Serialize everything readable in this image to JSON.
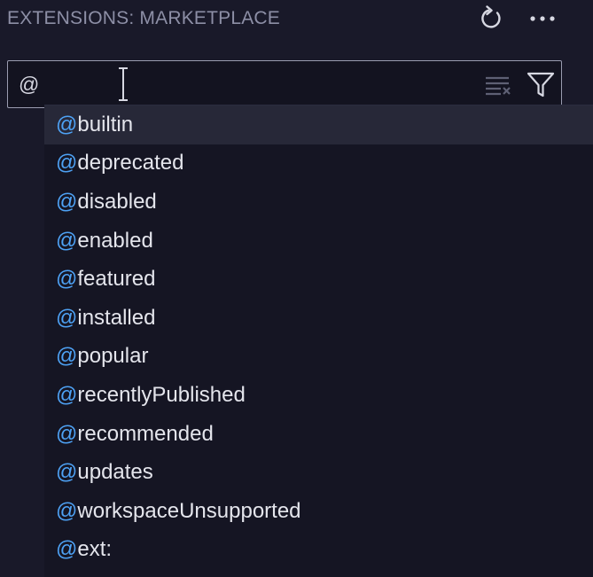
{
  "header": {
    "title": "EXTENSIONS: MARKETPLACE"
  },
  "search": {
    "value": "@"
  },
  "suggestions": {
    "prefix": "@",
    "items": [
      "builtin",
      "deprecated",
      "disabled",
      "enabled",
      "featured",
      "installed",
      "popular",
      "recentlyPublished",
      "recommended",
      "updates",
      "workspaceUnsupported",
      "ext:"
    ]
  },
  "colors": {
    "background": "#191929",
    "accent": "#4ea2f5",
    "text": "#e4e5ec",
    "selected": "#272838"
  },
  "icons": {
    "refresh": "refresh-icon",
    "more": "more-actions-icon",
    "clear": "clear-filter-icon",
    "filter": "filter-icon",
    "cursor": "text-cursor-icon"
  }
}
